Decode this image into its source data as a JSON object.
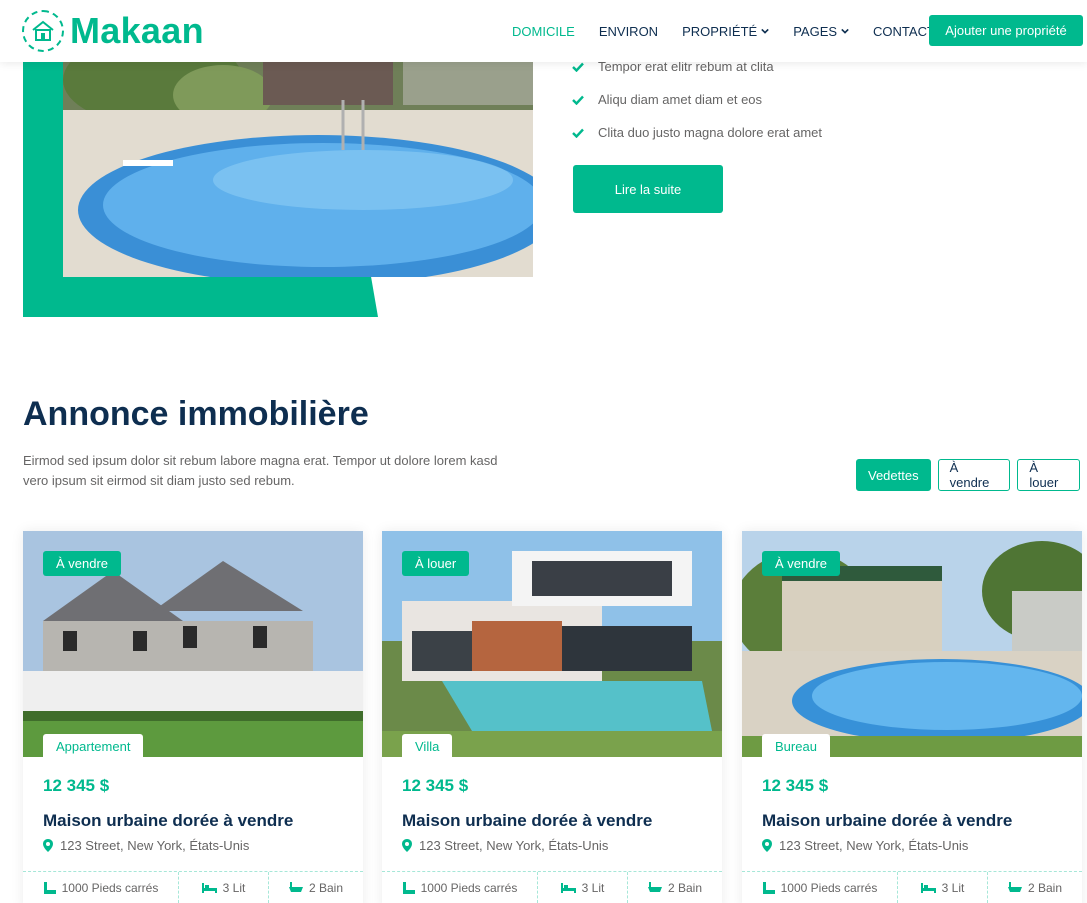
{
  "brand": {
    "name": "Makaan"
  },
  "nav": {
    "items": [
      {
        "label": "DOMICILE",
        "active": true,
        "dropdown": false
      },
      {
        "label": "ENVIRON",
        "active": false,
        "dropdown": false
      },
      {
        "label": "PROPRIÉTÉ",
        "active": false,
        "dropdown": true
      },
      {
        "label": "PAGES",
        "active": false,
        "dropdown": true
      },
      {
        "label": "CONTACT",
        "active": false,
        "dropdown": false
      }
    ],
    "cta_label": "Ajouter une propriété"
  },
  "about": {
    "checks": [
      "Tempor erat elitr rebum at clita",
      "Aliqu diam amet diam et eos",
      "Clita duo justo magna dolore erat amet"
    ],
    "read_more": "Lire la suite"
  },
  "listing": {
    "title": "Annonce immobilière",
    "description": "Eirmod sed ipsum dolor sit rebum labore magna erat. Tempor ut dolore lorem kasd vero ipsum sit eirmod sit diam justo sed rebum.",
    "filters": [
      {
        "label": "Vedettes",
        "active": true
      },
      {
        "label": "À vendre",
        "active": false
      },
      {
        "label": "À louer",
        "active": false
      }
    ],
    "cards": [
      {
        "status": "À vendre",
        "type": "Appartement",
        "price": "12 345 $",
        "title": "Maison urbaine dorée à vendre",
        "address": "123 Street, New York, États-Unis",
        "area": "1000 Pieds carrés",
        "beds": "3 Lit",
        "baths": "2 Bain"
      },
      {
        "status": "À louer",
        "type": "Villa",
        "price": "12 345 $",
        "title": "Maison urbaine dorée à vendre",
        "address": "123 Street, New York, États-Unis",
        "area": "1000 Pieds carrés",
        "beds": "3 Lit",
        "baths": "2 Bain"
      },
      {
        "status": "À vendre",
        "type": "Bureau",
        "price": "12 345 $",
        "title": "Maison urbaine dorée à vendre",
        "address": "123 Street, New York, États-Unis",
        "area": "1000 Pieds carrés",
        "beds": "3 Lit",
        "baths": "2 Bain"
      }
    ]
  },
  "colors": {
    "primary": "#00B98E",
    "dark": "#0E2E50",
    "text": "#666565"
  },
  "icons": [
    "logo-house-icon",
    "caret-down-icon",
    "check-icon",
    "map-marker-icon",
    "ruler-icon",
    "bed-icon",
    "bath-icon"
  ]
}
